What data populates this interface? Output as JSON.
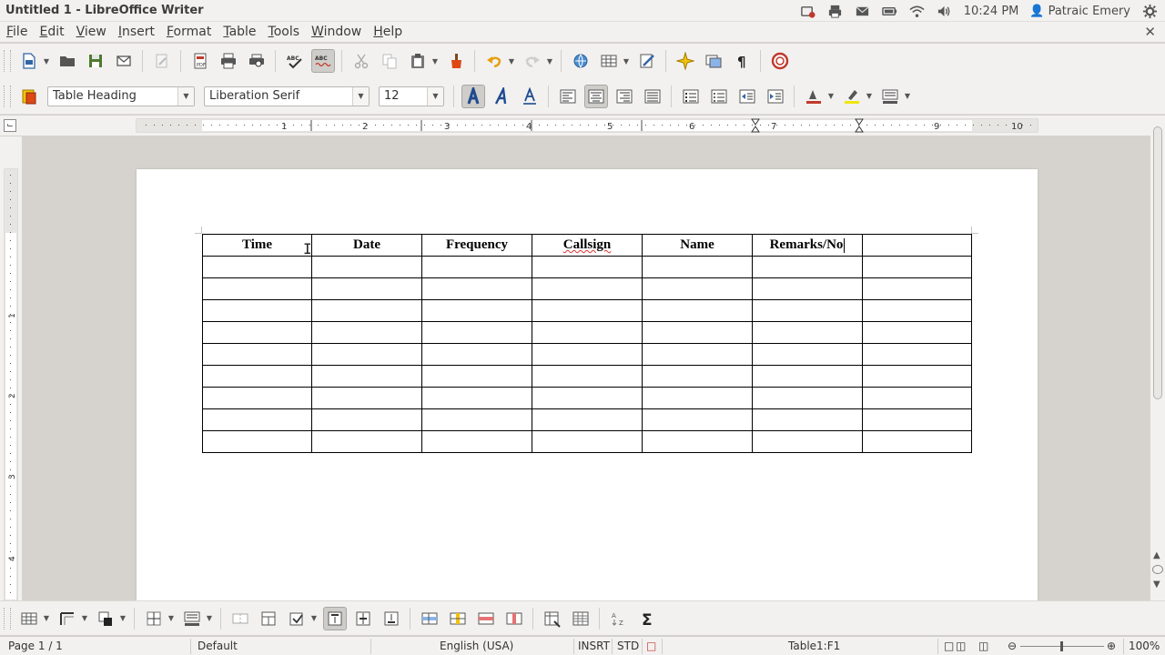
{
  "window": {
    "title": "Untitled 1 - LibreOffice Writer"
  },
  "indicators": {
    "time": "10:24 PM",
    "user": "Patraic Emery"
  },
  "menubar": [
    {
      "label": "File",
      "accel": "F",
      "rest": "ile"
    },
    {
      "label": "Edit",
      "accel": "E",
      "rest": "dit"
    },
    {
      "label": "View",
      "accel": "V",
      "rest": "iew"
    },
    {
      "label": "Insert",
      "accel": "I",
      "rest": "nsert"
    },
    {
      "label": "Format",
      "accel": "F",
      "rest": "ormat"
    },
    {
      "label": "Table",
      "accel": "T",
      "rest": "able"
    },
    {
      "label": "Tools",
      "accel": "T",
      "rest": "ools"
    },
    {
      "label": "Window",
      "accel": "W",
      "rest": "indow"
    },
    {
      "label": "Help",
      "accel": "H",
      "rest": "elp"
    }
  ],
  "formatting": {
    "paragraph_style": "Table Heading",
    "font_name": "Liberation Serif",
    "font_size": "12"
  },
  "ruler": {
    "numbers": [
      "1",
      "2",
      "3",
      "4",
      "5",
      "6",
      "7",
      "9",
      "10"
    ]
  },
  "table": {
    "headers": [
      "Time",
      "Date",
      "Frequency",
      "Callsign",
      "Name",
      "Remarks/No",
      ""
    ],
    "empty_rows": 9
  },
  "status": {
    "page": "Page 1 / 1",
    "page_style": "Default",
    "language": "English (USA)",
    "insert_mode": "INSRT",
    "selection_mode": "STD",
    "cell": "Table1:F1",
    "zoom": "100%"
  },
  "colors": {
    "chrome": "#f2f1f0",
    "workspace": "#d6d3ce",
    "accent_orange": "#dd4814"
  }
}
